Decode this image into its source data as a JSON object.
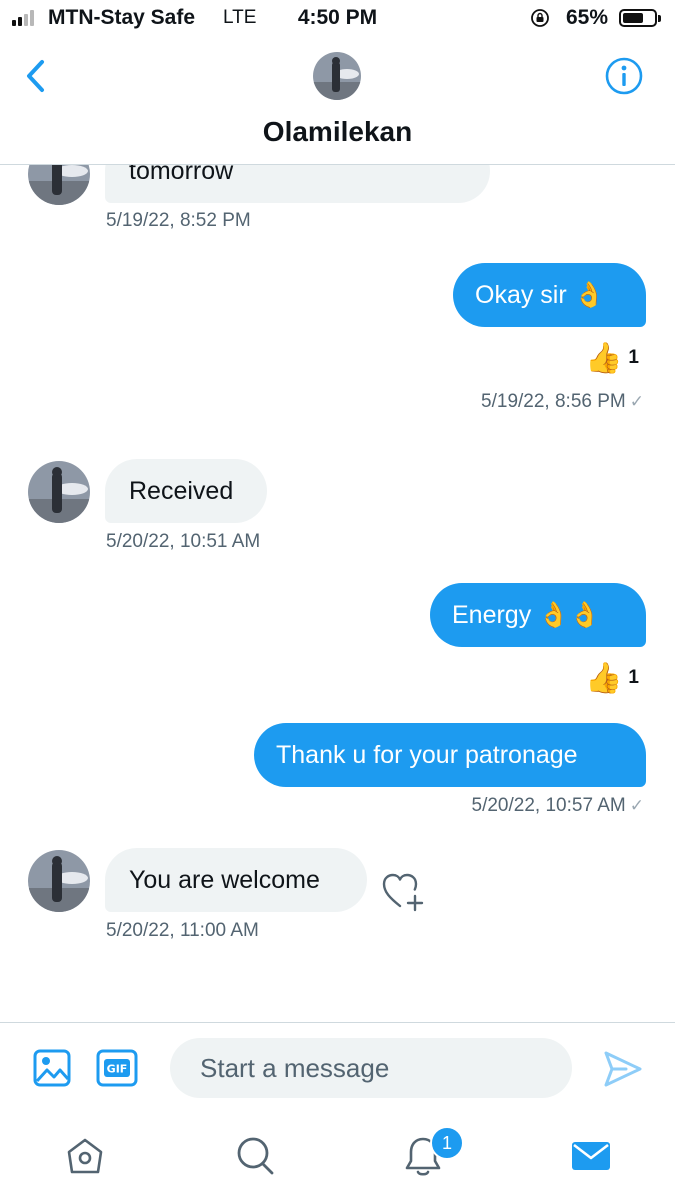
{
  "status_bar": {
    "carrier": "MTN-Stay Safe",
    "network": "LTE",
    "time": "4:50 PM",
    "battery": "65%",
    "battery_level": 0.65
  },
  "header": {
    "contact_name": "Olamilekan"
  },
  "messages": [
    {
      "direction": "in",
      "text": "tomorrow",
      "timestamp": "5/19/22, 8:52 PM"
    },
    {
      "direction": "out",
      "text": "Okay sir 👌",
      "reaction": "👍",
      "reaction_count": "1",
      "timestamp": "5/19/22, 8:56 PM",
      "status": "✓"
    },
    {
      "direction": "in",
      "text": "Received",
      "timestamp": "5/20/22, 10:51 AM"
    },
    {
      "direction": "out",
      "text": "Energy 👌👌",
      "reaction": "👍",
      "reaction_count": "1"
    },
    {
      "direction": "out",
      "text": "Thank u for your patronage",
      "timestamp": "5/20/22, 10:57 AM",
      "status": "✓"
    },
    {
      "direction": "in",
      "text": "You are welcome",
      "timestamp": "5/20/22, 11:00 AM"
    }
  ],
  "composer": {
    "placeholder": "Start a message"
  },
  "tab_bar": {
    "notifications_badge": "1"
  },
  "colors": {
    "accent": "#1d9bf0",
    "incoming_bubble": "#eff3f4",
    "secondary_text": "#536471"
  }
}
